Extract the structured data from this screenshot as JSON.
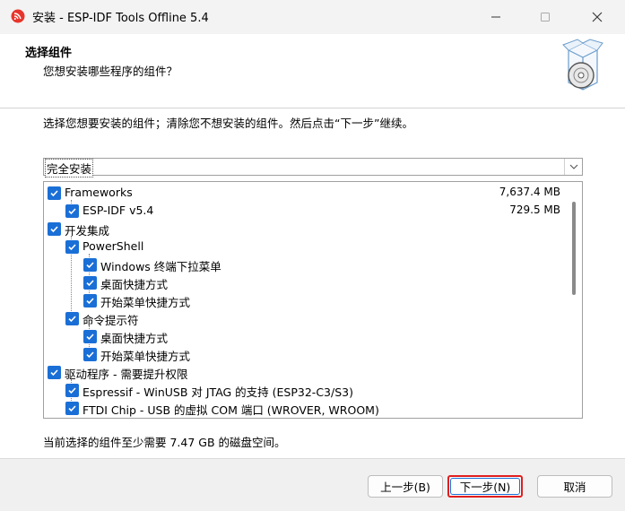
{
  "window": {
    "title": "安装 - ESP-IDF Tools Offline 5.4",
    "icon": "espressif-logo-icon"
  },
  "header": {
    "title": "选择组件",
    "subtitle": "您想安装哪些程序的组件？",
    "image": "install-box-disc-icon"
  },
  "instructions": "选择您想要安装的组件；清除您不想安装的组件。然后点击“下一步”继续。",
  "install_type": {
    "selected": "完全安装"
  },
  "components": [
    {
      "label": "Frameworks",
      "size": "7,637.4 MB",
      "checked": true,
      "level": 0
    },
    {
      "label": "ESP-IDF v5.4",
      "size": "729.5 MB",
      "checked": true,
      "level": 1
    },
    {
      "label": "开发集成",
      "size": "",
      "checked": true,
      "level": 0
    },
    {
      "label": "PowerShell",
      "size": "",
      "checked": true,
      "level": 1
    },
    {
      "label": "Windows 终端下拉菜单",
      "size": "",
      "checked": true,
      "level": 2
    },
    {
      "label": "桌面快捷方式",
      "size": "",
      "checked": true,
      "level": 2
    },
    {
      "label": "开始菜单快捷方式",
      "size": "",
      "checked": true,
      "level": 2
    },
    {
      "label": "命令提示符",
      "size": "",
      "checked": true,
      "level": 1
    },
    {
      "label": "桌面快捷方式",
      "size": "",
      "checked": true,
      "level": 2
    },
    {
      "label": "开始菜单快捷方式",
      "size": "",
      "checked": true,
      "level": 2
    },
    {
      "label": "驱动程序 - 需要提升权限",
      "size": "",
      "checked": true,
      "level": 0
    },
    {
      "label": "Espressif - WinUSB 对 JTAG 的支持 (ESP32-C3/S3)",
      "size": "",
      "checked": true,
      "level": 1
    },
    {
      "label": "FTDI Chip - USB 的虚拟 COM 端口 (WROVER, WROOM)",
      "size": "",
      "checked": true,
      "level": 1
    }
  ],
  "space_note": "当前选择的组件至少需要 7.47 GB 的磁盘空间。",
  "buttons": {
    "back": "上一步(B)",
    "next": "下一步(N)",
    "cancel": "取消"
  },
  "colors": {
    "checkbox": "#1a6fd6",
    "highlight_border": "#e01e1e"
  }
}
